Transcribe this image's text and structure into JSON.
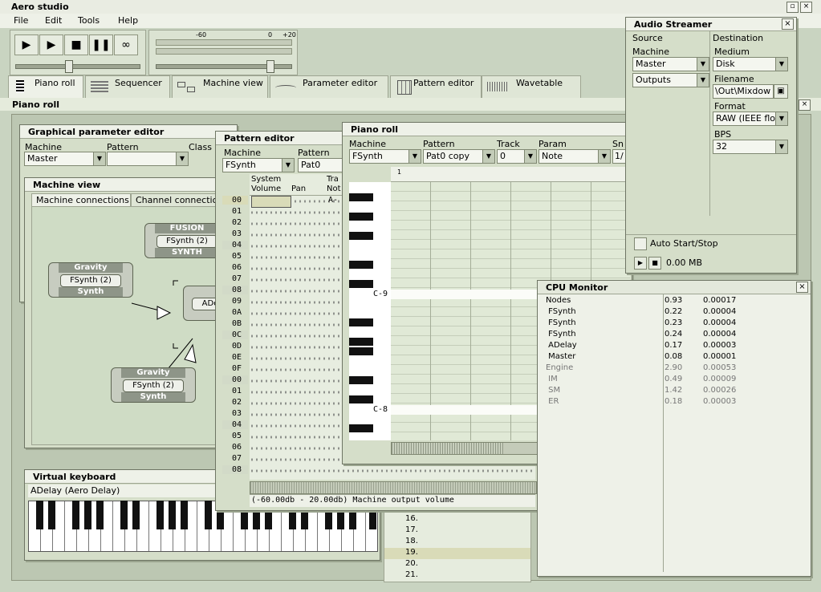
{
  "app": {
    "title": "Aero studio"
  },
  "menu": [
    "File",
    "Edit",
    "Tools",
    "Help"
  ],
  "meter": {
    "scale": [
      "-60",
      "0",
      "+20"
    ]
  },
  "tabs": [
    {
      "label": "Piano roll"
    },
    {
      "label": "Sequencer"
    },
    {
      "label": "Machine view"
    },
    {
      "label": "Parameter editor"
    },
    {
      "label": "Pattern editor"
    },
    {
      "label": "Wavetable"
    }
  ],
  "panel_heading": "Piano roll",
  "graphical_param": {
    "title": "Graphical parameter editor",
    "machine_label": "Machine",
    "pattern_label": "Pattern",
    "class_label": "Class",
    "machine_value": "Master"
  },
  "machine_view": {
    "title": "Machine view",
    "tab1": "Machine connections",
    "tab2": "Channel connectio",
    "nodes": [
      {
        "header": "FUSION",
        "name": "FSynth (2)",
        "footer": "SYNTH"
      },
      {
        "header": "Gravity",
        "name": "FSynth (2)",
        "footer": "Synth"
      },
      {
        "header": "",
        "name": "ADe",
        "footer": ""
      },
      {
        "header": "Gravity",
        "name": "FSynth (2)",
        "footer": "Synth"
      }
    ]
  },
  "pattern_editor": {
    "title": "Pattern editor",
    "machine_label": "Machine",
    "pattern_label": "Pattern",
    "machine_value": "FSynth",
    "pattern_value": "Pat0",
    "col_system": "System",
    "col_track": "Tra",
    "col_volume": "Volume",
    "col_pan": "Pan",
    "col_note": "Not",
    "rows": [
      "00",
      "01",
      "02",
      "03",
      "04",
      "05",
      "06",
      "07",
      "08",
      "09",
      "0A",
      "0B",
      "0C",
      "0D",
      "0E",
      "0F",
      "00",
      "01",
      "02",
      "03",
      "04",
      "05",
      "06",
      "07",
      "08"
    ],
    "first_note": "A-",
    "status": "(-60.00db - 20.00db) Machine output volume"
  },
  "piano_roll": {
    "title": "Piano roll",
    "machine_label": "Machine",
    "pattern_label": "Pattern",
    "track_label": "Track",
    "param_label": "Param",
    "sn_label": "Sn",
    "machine_value": "FSynth",
    "pattern_value": "Pat0 copy",
    "track_value": "0",
    "param_value": "Note",
    "sn_value": "1/",
    "ruler_mark": "1",
    "note_c9": "C-9",
    "note_c8": "C-8"
  },
  "audio_streamer": {
    "title": "Audio Streamer",
    "source_label": "Source",
    "destination_label": "Destination",
    "machine_label": "Machine",
    "machine_value": "Master",
    "outputs_value": "Outputs",
    "medium_label": "Medium",
    "medium_value": "Disk",
    "filename_label": "Filename",
    "filename_value": "\\Out\\Mixdow",
    "format_label": "Format",
    "format_value": "RAW (IEEE flo",
    "bps_label": "BPS",
    "bps_value": "32",
    "auto_label": "Auto Start/Stop",
    "size_value": "0.00 MB"
  },
  "cpu_monitor": {
    "title": "CPU Monitor",
    "rows": [
      {
        "name": "Nodes",
        "a": "0.93",
        "b": "0.00017",
        "dim": false
      },
      {
        "name": " FSynth",
        "a": "0.22",
        "b": "0.00004",
        "dim": false
      },
      {
        "name": " FSynth",
        "a": "0.23",
        "b": "0.00004",
        "dim": false
      },
      {
        "name": " FSynth",
        "a": "0.24",
        "b": "0.00004",
        "dim": false
      },
      {
        "name": " ADelay",
        "a": "0.17",
        "b": "0.00003",
        "dim": false
      },
      {
        "name": " Master",
        "a": "0.08",
        "b": "0.00001",
        "dim": false
      },
      {
        "name": "Engine",
        "a": "2.90",
        "b": "0.00053",
        "dim": true
      },
      {
        "name": " IM",
        "a": "0.49",
        "b": "0.00009",
        "dim": true
      },
      {
        "name": " SM",
        "a": "1.42",
        "b": "0.00026",
        "dim": true
      },
      {
        "name": " ER",
        "a": "0.18",
        "b": "0.00003",
        "dim": true
      }
    ]
  },
  "virtual_keyboard": {
    "title": "Virtual keyboard",
    "machine_value": "ADelay (Aero Delay)"
  },
  "sequencer_rows": [
    "16.",
    "17.",
    "18.",
    "19.",
    "20.",
    "21."
  ],
  "colors": {
    "accent": "#d5dec9",
    "title": "#eef1e8",
    "highlight": "#d9dbb8"
  }
}
